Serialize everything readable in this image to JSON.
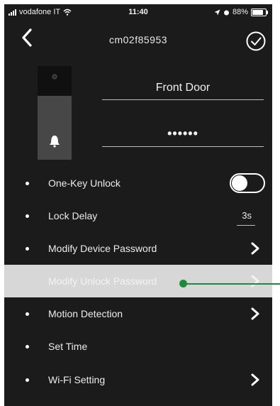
{
  "status_bar": {
    "carrier": "vodafone IT",
    "time": "11:40",
    "battery": "88%",
    "battery_level": 0.88
  },
  "nav": {
    "title": "cm02f85953",
    "back_icon": "chevron-left-icon",
    "confirm_icon": "checkmark-circle-icon"
  },
  "device": {
    "name": "Front Door",
    "password_masked": "••••••"
  },
  "settings": {
    "one_key_unlock": {
      "label": "One-Key Unlock",
      "enabled": false
    },
    "lock_delay": {
      "label": "Lock Delay",
      "value": "3s"
    },
    "modify_device_password": {
      "label": "Modify Device Password"
    },
    "modify_unlock_password": {
      "label": "Modify Unlock Password",
      "disabled": true
    },
    "motion_detection": {
      "label": "Motion Detection"
    },
    "set_time": {
      "label": "Set Time"
    },
    "wifi_setting": {
      "label": "Wi-Fi Setting"
    }
  },
  "colors": {
    "background": "#1b1b1b",
    "disabled_row": "#d7d7d7",
    "annotation": "#1f8a3a"
  }
}
